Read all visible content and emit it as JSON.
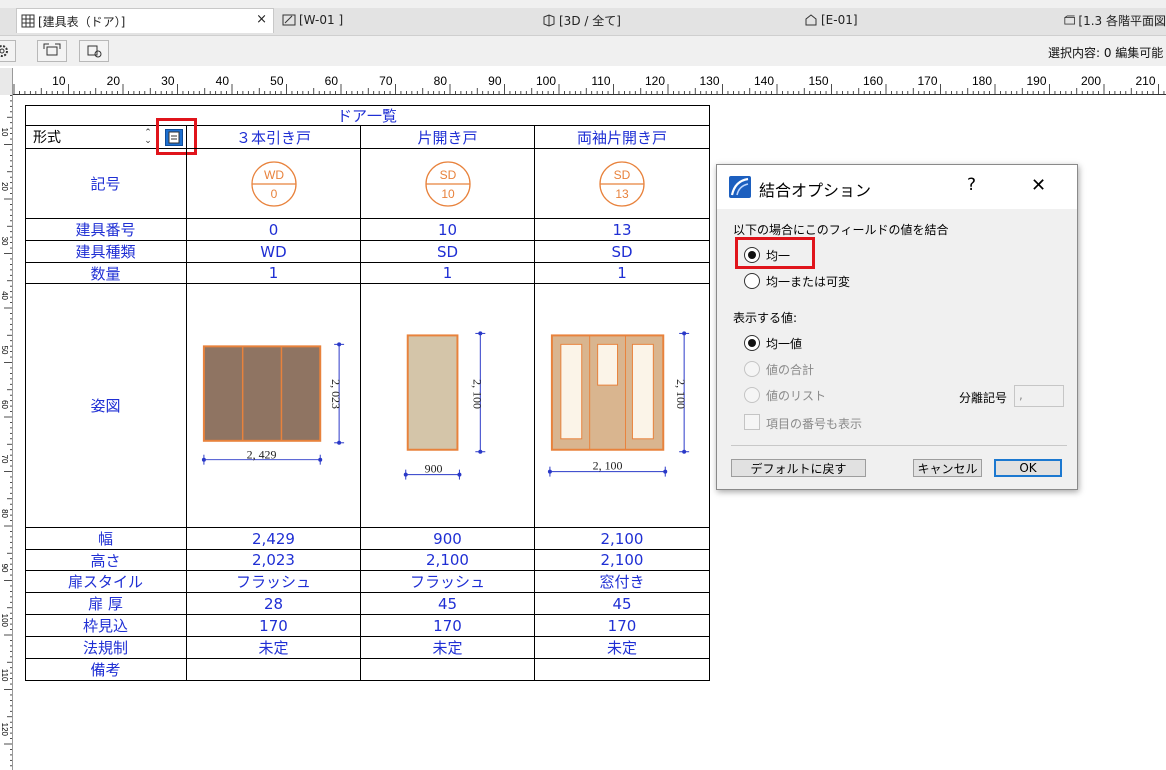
{
  "tabs": [
    {
      "label": "[建具表（ドア）]",
      "close": "×"
    },
    {
      "label": "[W-01 ]"
    },
    {
      "label": "[3D / 全て]"
    },
    {
      "label": "[E-01]"
    },
    {
      "label": "[1.3 各階平面図"
    }
  ],
  "toolbar": {
    "status": "選択内容: 0  編集可能"
  },
  "ruler": {
    "h_labels": [
      "10",
      "20",
      "30",
      "40",
      "50",
      "60",
      "70",
      "80",
      "90",
      "100",
      "110",
      "120",
      "130",
      "140",
      "150",
      "160",
      "170",
      "180",
      "190",
      "200",
      "210"
    ],
    "v_labels": [
      "10",
      "20",
      "30",
      "40",
      "50",
      "60",
      "70",
      "80",
      "90",
      "100",
      "110",
      "120"
    ]
  },
  "schedule": {
    "title": "ドア一覧",
    "header_label": "形式",
    "columns": [
      "３本引き戸",
      "片開き戸",
      "両袖片開き戸"
    ],
    "row_labels": {
      "symbol": "記号",
      "number": "建具番号",
      "type": "建具種類",
      "qty": "数量",
      "figure": "姿図",
      "width": "幅",
      "height": "高さ",
      "style": "扉スタイル",
      "thickness": "扉 厚",
      "frame": "枠見込",
      "law": "法規制",
      "note": "備考"
    },
    "symbols": [
      {
        "code": "WD",
        "num": "0"
      },
      {
        "code": "SD",
        "num": "10"
      },
      {
        "code": "SD",
        "num": "13"
      }
    ],
    "rows": {
      "number": [
        "0",
        "10",
        "13"
      ],
      "type": [
        "WD",
        "SD",
        "SD"
      ],
      "qty": [
        "1",
        "1",
        "1"
      ],
      "width": [
        "2,429",
        "900",
        "2,100"
      ],
      "height": [
        "2,023",
        "2,100",
        "2,100"
      ],
      "style": [
        "フラッシュ",
        "フラッシュ",
        "窓付き"
      ],
      "thickness": [
        "28",
        "45",
        "45"
      ],
      "frame": [
        "170",
        "170",
        "170"
      ],
      "law": [
        "未定",
        "未定",
        "未定"
      ],
      "note": [
        "",
        "",
        ""
      ]
    },
    "figures": [
      {
        "w_dim": "2, 429",
        "h_dim": "2, 023"
      },
      {
        "w_dim": "900",
        "h_dim": "2, 100"
      },
      {
        "w_dim": "2, 100",
        "h_dim": "2, 100"
      }
    ]
  },
  "dialog": {
    "title": "結合オプション",
    "help": "?",
    "close": "✕",
    "merge_group_label": "以下の場合にこのフィールドの値を結合",
    "merge_options": [
      "均一",
      "均一または可変"
    ],
    "merge_selected": 0,
    "display_group_label": "表示する値:",
    "display_options": [
      "均一値",
      "値の合計",
      "値のリスト"
    ],
    "display_selected": 0,
    "separator_label": "分離記号",
    "separator_value": ",",
    "show_item_numbers": "項目の番号も表示",
    "btn_default": "デフォルトに戻す",
    "btn_cancel": "キャンセル",
    "btn_ok": "OK"
  },
  "colors": {
    "schedule_text": "#1f2fd4",
    "highlight": "#e0141b",
    "door_sliding": "#8f7462",
    "door_swing": "#d4c5a9",
    "door_outline": "#e8823c",
    "dimension": "#2a39c8"
  }
}
